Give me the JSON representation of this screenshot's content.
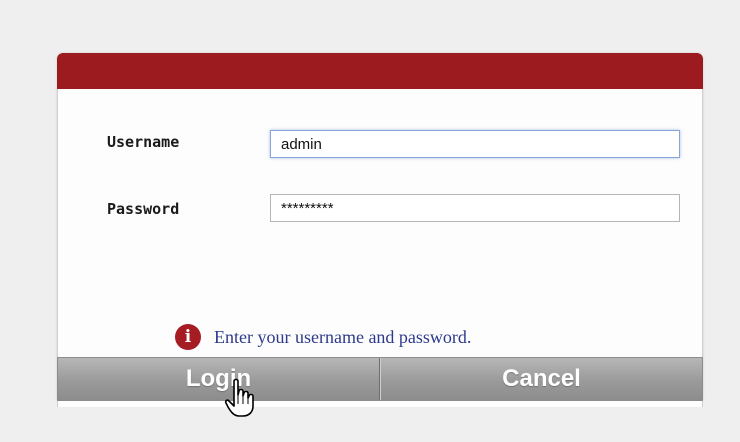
{
  "form": {
    "username_label": "Username",
    "username_value": "admin",
    "password_label": "Password",
    "password_value": "*********"
  },
  "message": {
    "icon": "info-icon",
    "icon_glyph": "i",
    "text": "Enter your username and password."
  },
  "buttons": {
    "login_label": "Login",
    "cancel_label": "Cancel"
  },
  "colors": {
    "titlebar": "#9b1b1f",
    "info_icon": "#a51d22",
    "message_text": "#2d3a8c",
    "button": "#9a9a9a"
  }
}
